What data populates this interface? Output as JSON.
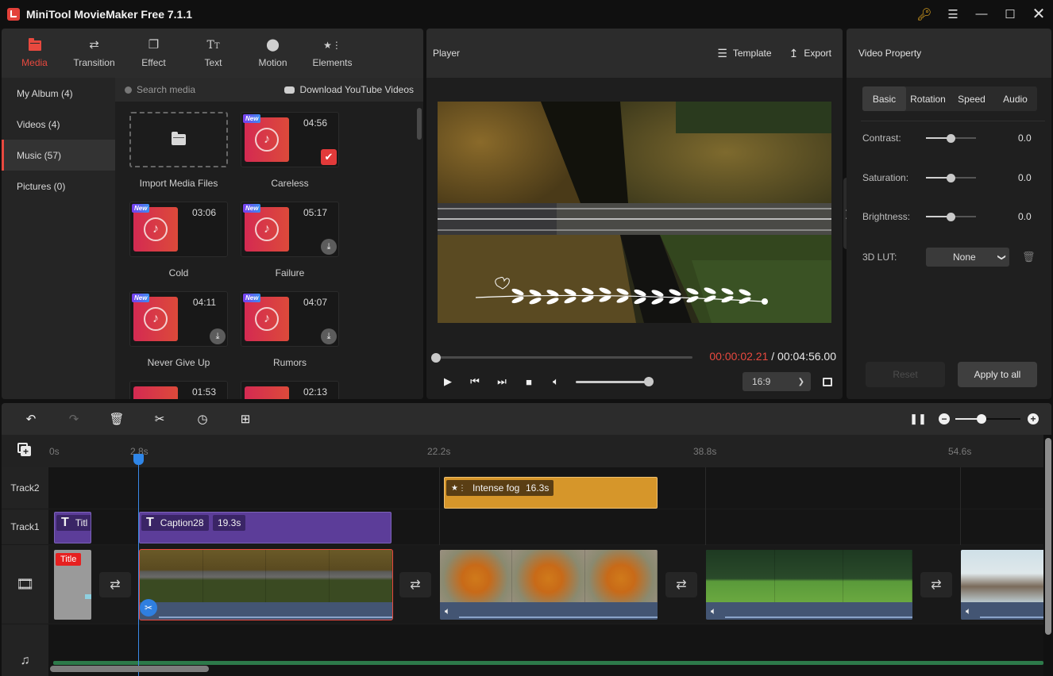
{
  "app": {
    "title": "MiniTool MovieMaker Free 7.1.1",
    "window_controls": [
      "key-icon",
      "menu-icon",
      "minimize-icon",
      "maximize-icon",
      "close-icon"
    ]
  },
  "toolbar": {
    "tabs": [
      {
        "label": "Media",
        "icon": "folder-icon",
        "active": true
      },
      {
        "label": "Transition",
        "icon": "transition-arrows-icon",
        "active": false
      },
      {
        "label": "Effect",
        "icon": "effect-squares-icon",
        "active": false
      },
      {
        "label": "Text",
        "icon": "text-tt-icon",
        "active": false
      },
      {
        "label": "Motion",
        "icon": "motion-ball-icon",
        "active": false
      },
      {
        "label": "Elements",
        "icon": "elements-star-icon",
        "active": false
      }
    ]
  },
  "media": {
    "categories": [
      {
        "label": "My Album (4)",
        "active": false
      },
      {
        "label": "Videos (4)",
        "active": false
      },
      {
        "label": "Music (57)",
        "active": true
      },
      {
        "label": "Pictures (0)",
        "active": false
      }
    ],
    "search_placeholder": "Search media",
    "download_link": "Download YouTube Videos",
    "import_label": "Import Media Files",
    "items": [
      {
        "name": "Careless",
        "duration": "04:56",
        "new": true,
        "state": "added"
      },
      {
        "name": "Cold",
        "duration": "03:06",
        "new": true,
        "state": "none"
      },
      {
        "name": "Failure",
        "duration": "05:17",
        "new": true,
        "state": "download"
      },
      {
        "name": "Never Give Up",
        "duration": "04:11",
        "new": true,
        "state": "download"
      },
      {
        "name": "Rumors",
        "duration": "04:07",
        "new": true,
        "state": "download"
      },
      {
        "name": "",
        "duration": "01:53",
        "new": false,
        "state": "none"
      },
      {
        "name": "",
        "duration": "02:13",
        "new": false,
        "state": "none"
      }
    ],
    "new_badge": "New"
  },
  "player": {
    "title": "Player",
    "template_label": "Template",
    "export_label": "Export",
    "current_time": "00:00:02.21",
    "separator": " / ",
    "total_time": "00:04:56.00",
    "progress_fraction": 0.0075,
    "volume_fraction": 1.0,
    "aspect_ratio": "16:9"
  },
  "properties": {
    "title": "Video Property",
    "tabs": [
      {
        "label": "Basic",
        "active": true
      },
      {
        "label": "Rotation",
        "active": false
      },
      {
        "label": "Speed",
        "active": false
      },
      {
        "label": "Audio",
        "active": false
      }
    ],
    "sliders": [
      {
        "label": "Contrast:",
        "value": "0.0",
        "fraction": 0.5
      },
      {
        "label": "Saturation:",
        "value": "0.0",
        "fraction": 0.5
      },
      {
        "label": "Brightness:",
        "value": "0.0",
        "fraction": 0.5
      }
    ],
    "lut_label": "3D LUT:",
    "lut_value": "None",
    "reset_label": "Reset",
    "apply_label": "Apply to all"
  },
  "timeline": {
    "zoom_fraction": 0.4,
    "ruler": [
      "0s",
      "2.8s",
      "22.2s",
      "38.8s",
      "54.6s"
    ],
    "tracks": {
      "track2_label": "Track2",
      "track1_label": "Track1"
    },
    "track2_clips": [
      {
        "name": "Intense fog",
        "duration": "16.3s"
      }
    ],
    "track1_clips": [
      {
        "name": "Titl",
        "duration": ""
      },
      {
        "name": "Caption28",
        "duration": "19.3s"
      }
    ],
    "video_clips": [
      {
        "badge": "Title",
        "kind": "title"
      },
      {
        "kind": "aerial-road",
        "selected": true
      },
      {
        "kind": "autumn-leaves"
      },
      {
        "kind": "cows-meadow"
      },
      {
        "kind": "office-cartoon"
      }
    ]
  }
}
